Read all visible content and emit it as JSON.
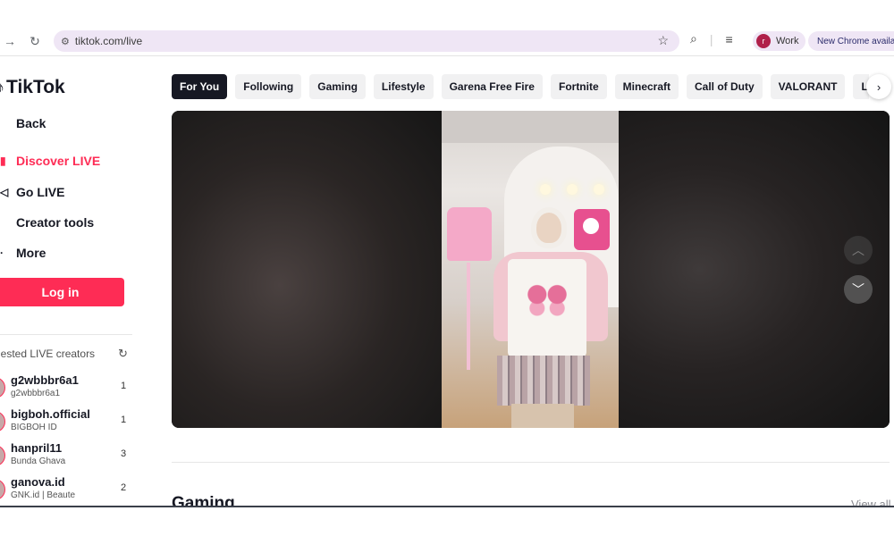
{
  "browser": {
    "url": "tiktok.com/live",
    "profile_initial": "r",
    "profile_label": "Work",
    "update_label": "New Chrome availab"
  },
  "sidebar": {
    "logo": "TikTok",
    "nav": [
      {
        "label": "Back",
        "icon": "back-arrow-icon"
      },
      {
        "label": "Discover LIVE",
        "icon": "live-icon",
        "active": true
      },
      {
        "label": "Go LIVE",
        "icon": "camera-icon"
      },
      {
        "label": "Creator tools",
        "icon": "tools-icon"
      },
      {
        "label": "More",
        "icon": "chevron-icon"
      }
    ],
    "login_label": "Log in",
    "suggested_title": "gested LIVE creators",
    "creators": [
      {
        "name": "g2wbbbr6a1",
        "sub": "g2wbbbr6a1",
        "count": "1"
      },
      {
        "name": "bigboh.official",
        "sub": "BIGBOH ID",
        "count": "1"
      },
      {
        "name": "hanpril11",
        "sub": "Bunda Ghava",
        "count": "3"
      },
      {
        "name": "ganova.id",
        "sub": "GNK.id | Beaute",
        "count": "2"
      }
    ]
  },
  "categories": [
    "For You",
    "Following",
    "Gaming",
    "Lifestyle",
    "Garena Free Fire",
    "Fortnite",
    "Minecraft",
    "Call of Duty",
    "VALORANT",
    "League of L"
  ],
  "selected_category": "For You",
  "section": {
    "title": "Gaming",
    "view_all": "View all"
  },
  "colors": {
    "accent": "#fe2c55",
    "text": "#161823",
    "chip_bg": "#f1f1f2"
  }
}
